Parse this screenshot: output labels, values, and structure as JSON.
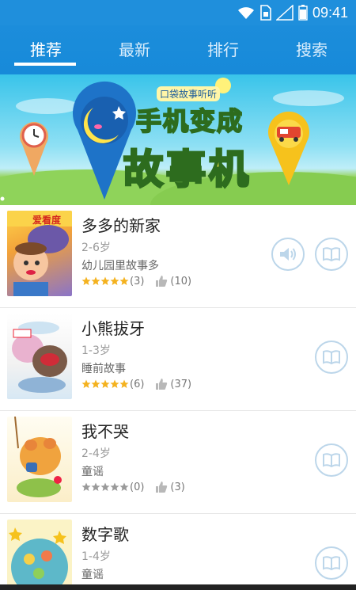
{
  "status_bar": {
    "time": "09:41",
    "icons": [
      "wifi-icon",
      "sim-icon",
      "signal-icon",
      "battery-icon"
    ]
  },
  "tabs": [
    {
      "label": "推荐",
      "active": true
    },
    {
      "label": "最新",
      "active": false
    },
    {
      "label": "排行",
      "active": false
    },
    {
      "label": "搜索",
      "active": false
    }
  ],
  "banner": {
    "subtitle": "口袋故事听听",
    "title_line1": "手机变成",
    "title_line2": "故事机",
    "icons": [
      "alarm-clock-icon",
      "moon-pin-icon",
      "car-pin-icon"
    ],
    "slide_count": 1,
    "active_slide": 0
  },
  "stories": [
    {
      "title": "多多的新家",
      "age": "2-6岁",
      "category": "幼儿园里故事多",
      "stars": 5,
      "rating_count": "(3)",
      "likes": "(10)",
      "has_audio": true,
      "cover_text": "爱看度"
    },
    {
      "title": "小熊拔牙",
      "age": "1-3岁",
      "category": "睡前故事",
      "stars": 5,
      "rating_count": "(6)",
      "likes": "(37)",
      "has_audio": false,
      "cover_text": ""
    },
    {
      "title": "我不哭",
      "age": "2-4岁",
      "category": "童谣",
      "stars": 0,
      "rating_count": "(0)",
      "likes": "(3)",
      "has_audio": false,
      "cover_text": ""
    },
    {
      "title": "数字歌",
      "age": "1-4岁",
      "category": "童谣",
      "stars": 0,
      "rating_count": "",
      "likes": "",
      "has_audio": false,
      "cover_text": ""
    }
  ],
  "colors": {
    "accent": "#1f8fdc",
    "star_filled": "#f4b21f",
    "star_empty": "#9a9a9a",
    "button_border": "#bcd6ea"
  }
}
